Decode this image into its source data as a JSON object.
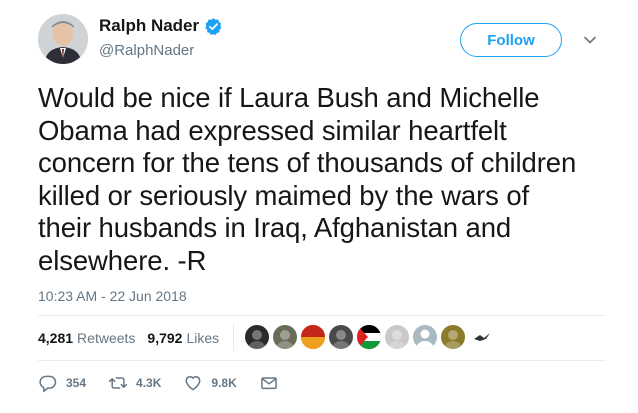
{
  "author": {
    "display_name": "Ralph Nader",
    "handle": "@RalphNader",
    "verified_icon": "verified-badge-icon",
    "avatar_icon": "profile-photo"
  },
  "follow_button": {
    "label": "Follow"
  },
  "menu": {
    "icon": "chevron-down-icon"
  },
  "tweet": {
    "lines": [
      "Would be nice if Laura Bush and Michelle",
      "Obama had expressed similar heartfelt",
      "concern for the tens of thousands of children",
      "killed or seriously maimed by the wars of",
      "their husbands in Iraq, Afghanistan and",
      "elsewhere. -R"
    ],
    "timestamp": "10:23 AM - 22 Jun 2018"
  },
  "stats": {
    "retweets_count": "4,281",
    "retweets_label": "Retweets",
    "likes_count": "9,792",
    "likes_label": "Likes"
  },
  "likers": [
    {
      "name": "liker-avatar-1",
      "color": "#2b2b2b"
    },
    {
      "name": "liker-avatar-2",
      "color": "#6b6b5a"
    },
    {
      "name": "liker-avatar-3",
      "color": "#e8501c"
    },
    {
      "name": "liker-avatar-4",
      "color": "#4a4a4a"
    },
    {
      "name": "liker-avatar-5",
      "color": "#1f7a2e"
    },
    {
      "name": "liker-avatar-6",
      "color": "#c9c9c9"
    },
    {
      "name": "liker-avatar-7",
      "color": "#aab8c2"
    },
    {
      "name": "liker-avatar-8",
      "color": "#8a7a2a"
    },
    {
      "name": "liker-avatar-9",
      "color": "#ffffff"
    }
  ],
  "actions": {
    "reply": {
      "icon": "reply-icon",
      "count": "354"
    },
    "retweet": {
      "icon": "retweet-icon",
      "count": "4.3K"
    },
    "like": {
      "icon": "heart-icon",
      "count": "9.8K"
    },
    "dm": {
      "icon": "envelope-icon"
    }
  },
  "colors": {
    "accent": "#1da1f2",
    "muted": "#657786",
    "text": "#14171a",
    "divider": "#e6ecf0"
  }
}
